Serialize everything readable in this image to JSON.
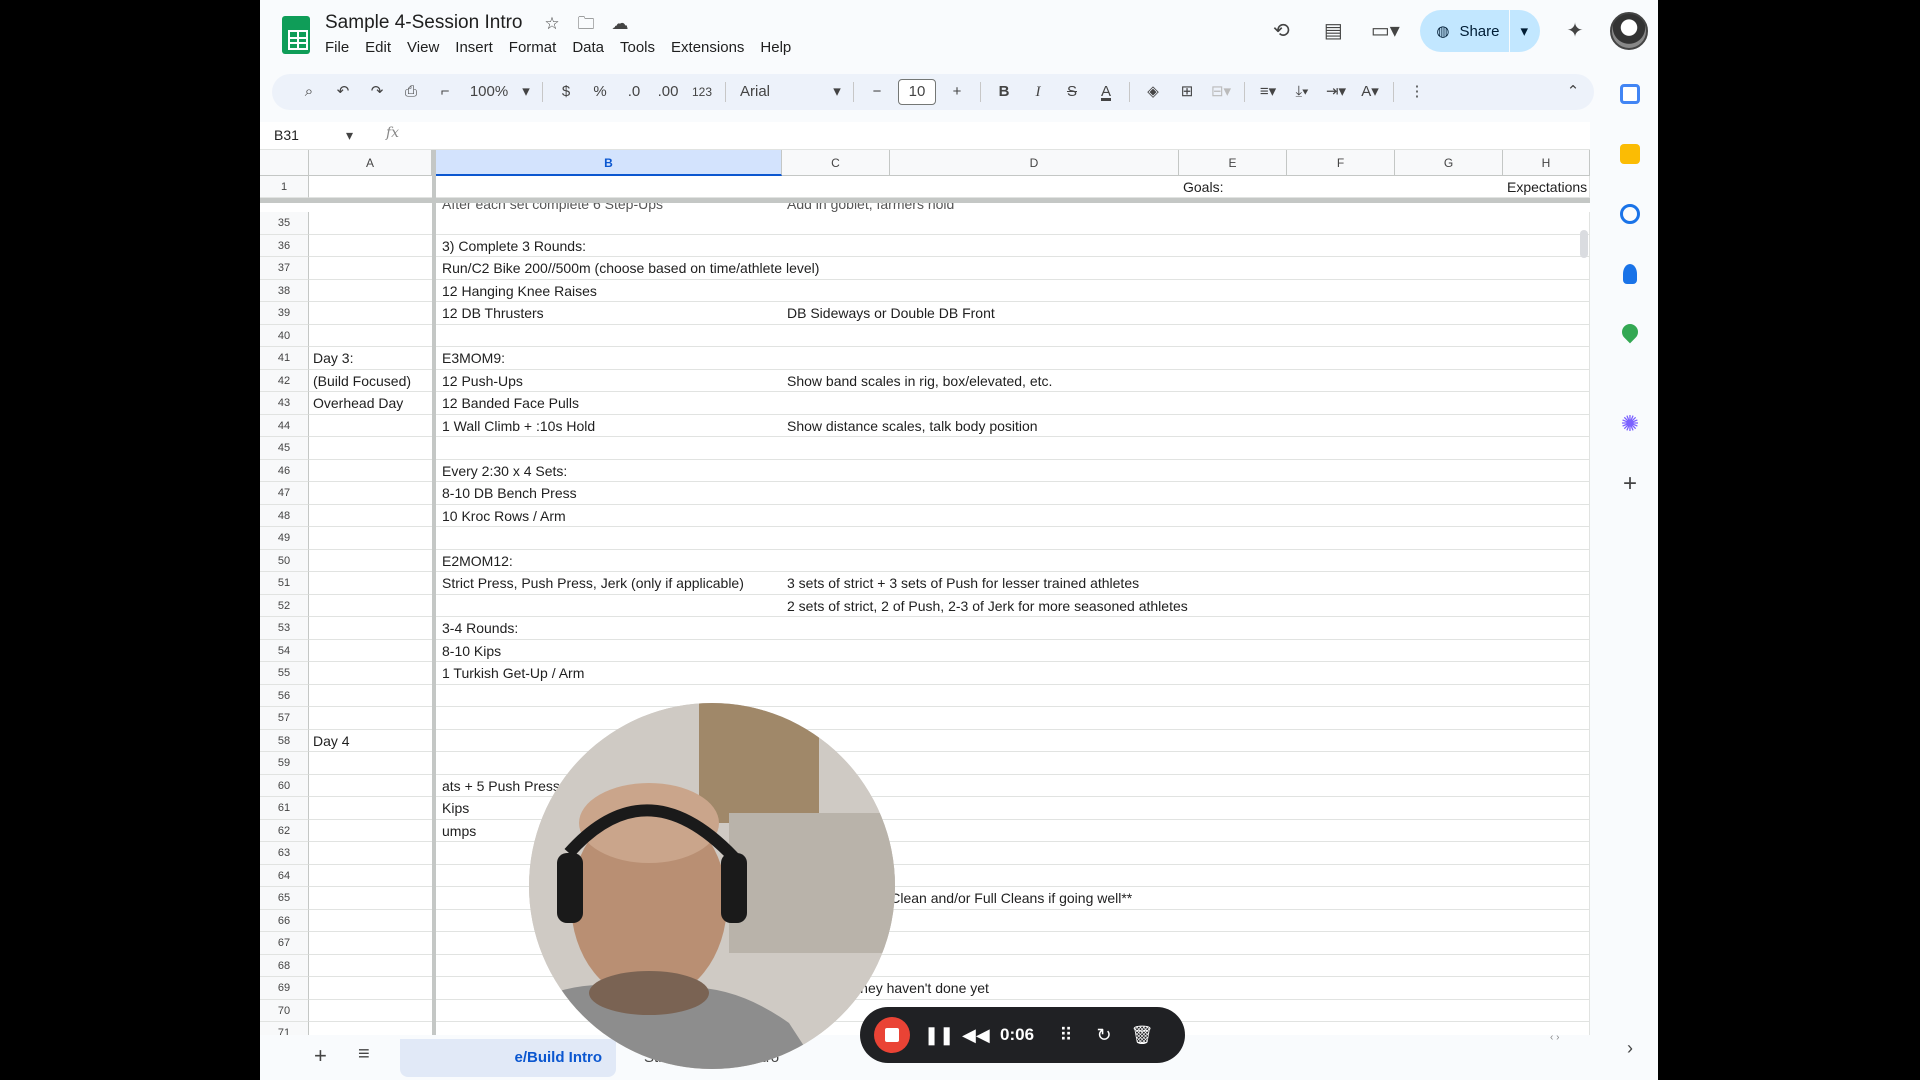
{
  "document": {
    "title": "Sample 4-Session Intro",
    "menu": [
      "File",
      "Edit",
      "View",
      "Insert",
      "Format",
      "Data",
      "Tools",
      "Extensions",
      "Help"
    ]
  },
  "header": {
    "share_label": "Share"
  },
  "toolbar": {
    "zoom": "100%",
    "currency": "$",
    "percent": "%",
    "dec_decrease": ".0",
    "dec_increase": ".00",
    "number_format": "123",
    "font": "Arial",
    "font_size": "10",
    "bold": "B",
    "italic": "I",
    "strike": "S",
    "text_color": "A"
  },
  "formula_bar": {
    "name_box": "B31",
    "fx": "fx"
  },
  "columns": [
    "A",
    "B",
    "C",
    "D",
    "E",
    "F",
    "G",
    "H"
  ],
  "frozen_row": {
    "number": "1",
    "goals_label": "Goals:",
    "expectations_label": "Expectations"
  },
  "rows": [
    {
      "n": "35",
      "a": "",
      "b": "",
      "c": ""
    },
    {
      "n": "36",
      "a": "",
      "b": "3) Complete 3 Rounds:",
      "c": ""
    },
    {
      "n": "37",
      "a": "",
      "b": "Run/C2 Bike 200//500m (choose based on time/athlete level)",
      "c": ""
    },
    {
      "n": "38",
      "a": "",
      "b": "12 Hanging Knee Raises",
      "c": ""
    },
    {
      "n": "39",
      "a": "",
      "b": "12 DB Thrusters",
      "c": "DB Sideways or Double DB Front"
    },
    {
      "n": "40",
      "a": "",
      "b": "",
      "c": ""
    },
    {
      "n": "41",
      "a": "Day 3:",
      "b": "E3MOM9:",
      "c": ""
    },
    {
      "n": "42",
      "a": "(Build Focused)",
      "b": "12 Push-Ups",
      "c": "Show band scales in rig, box/elevated, etc."
    },
    {
      "n": "43",
      "a": "Overhead Day",
      "b": "12 Banded Face Pulls",
      "c": ""
    },
    {
      "n": "44",
      "a": "",
      "b": "1 Wall Climb + :10s Hold",
      "c": "Show distance scales, talk body position"
    },
    {
      "n": "45",
      "a": "",
      "b": "",
      "c": ""
    },
    {
      "n": "46",
      "a": "",
      "b": "Every 2:30 x 4 Sets:",
      "c": ""
    },
    {
      "n": "47",
      "a": "",
      "b": "8-10 DB Bench Press",
      "c": ""
    },
    {
      "n": "48",
      "a": "",
      "b": "10 Kroc Rows / Arm",
      "c": ""
    },
    {
      "n": "49",
      "a": "",
      "b": "",
      "c": ""
    },
    {
      "n": "50",
      "a": "",
      "b": "E2MOM12:",
      "c": ""
    },
    {
      "n": "51",
      "a": "",
      "b": "Strict Press, Push Press, Jerk (only if applicable)",
      "c": "3 sets of strict + 3 sets of Push for lesser trained athletes"
    },
    {
      "n": "52",
      "a": "",
      "b": "",
      "c": "2 sets of strict, 2 of Push, 2-3 of Jerk for more seasoned athletes"
    },
    {
      "n": "53",
      "a": "",
      "b": "3-4 Rounds:",
      "c": ""
    },
    {
      "n": "54",
      "a": "",
      "b": "8-10 Kips",
      "c": ""
    },
    {
      "n": "55",
      "a": "",
      "b": "1 Turkish Get-Up / Arm",
      "c": ""
    },
    {
      "n": "56",
      "a": "",
      "b": "",
      "c": ""
    },
    {
      "n": "57",
      "a": "",
      "b": "",
      "c": ""
    },
    {
      "n": "58",
      "a": "Day 4",
      "b": "",
      "c": ""
    },
    {
      "n": "59",
      "a": "",
      "b": "",
      "c": ""
    },
    {
      "n": "60",
      "a": "",
      "b": "ats + 5 Push Press",
      "c": ""
    },
    {
      "n": "61",
      "a": "",
      "b": "Kips",
      "c": ""
    },
    {
      "n": "62",
      "a": "",
      "b": "umps",
      "c": ""
    },
    {
      "n": "63",
      "a": "",
      "b": "",
      "c": ""
    },
    {
      "n": "64",
      "a": "",
      "b": "",
      "c": ""
    },
    {
      "n": "65",
      "a": "",
      "b": "",
      "c": "**Work to Squat Clean and/or Full Cleans if going well**"
    },
    {
      "n": "66",
      "a": "",
      "b": "",
      "c": ""
    },
    {
      "n": "67",
      "a": "",
      "b": "",
      "c": ""
    },
    {
      "n": "68",
      "a": "",
      "b": "",
      "c": ""
    },
    {
      "n": "69",
      "a": "",
      "b": "",
      "c": "A Machine they haven't done yet"
    },
    {
      "n": "70",
      "a": "",
      "b": "",
      "c": ""
    },
    {
      "n": "71",
      "a": "",
      "b": "",
      "c": ""
    }
  ],
  "partial_row_text": {
    "b": "After each set complete 6 Step-Ups",
    "c": "Add in goblet, farmers hold"
  },
  "sheet_tabs": [
    "e/Build Intro",
    "Strength/Camp Intro"
  ],
  "recorder": {
    "time": "0:06"
  },
  "colors": {
    "accent": "#0b57d0",
    "share_bg": "#c2e7ff",
    "sheets_green": "#0f9d58",
    "record_red": "#ea4335"
  },
  "icons": {
    "title": [
      "star-icon",
      "move-folder-icon",
      "cloud-status-icon"
    ],
    "header_right": [
      "history-icon",
      "comments-icon",
      "meet-icon",
      "gemini-icon"
    ],
    "side_panel": [
      "calendar-icon",
      "keep-icon",
      "tasks-icon",
      "contacts-icon",
      "maps-icon",
      "addon-icon",
      "add-icon"
    ]
  }
}
